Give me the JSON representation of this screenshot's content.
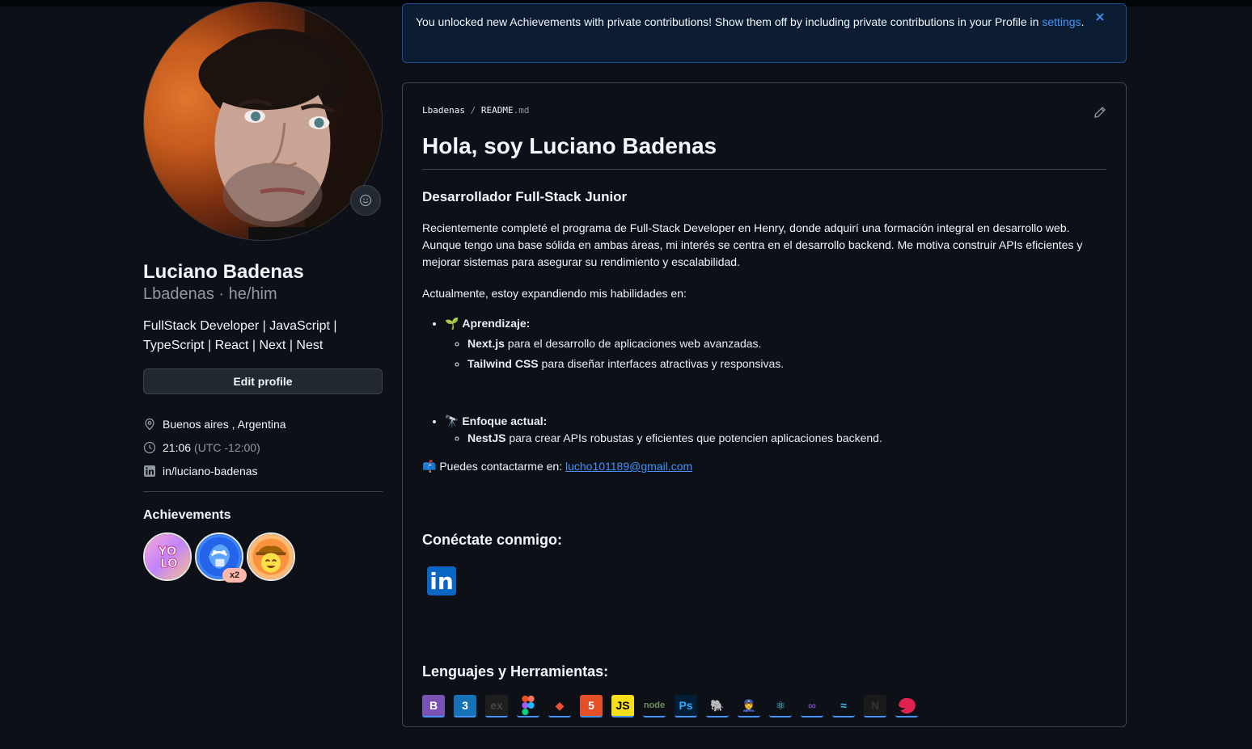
{
  "profile": {
    "name": "Luciano Badenas",
    "username_line": "Lbadenas · he/him",
    "bio_line1": "FullStack Developer | JavaScript |",
    "bio_line2": "TypeScript | React | Next | Nest",
    "edit_label": "Edit profile",
    "location": "Buenos aires , Argentina",
    "time": "21:06",
    "timezone": "(UTC -12:00)",
    "linkedin": "in/luciano-badenas",
    "achievements_title": "Achievements",
    "badge_count": "x2"
  },
  "flash": {
    "text": "You unlocked new Achievements with private contributions! Show them off by including private contributions in your Profile in",
    "link": "settings",
    "tail": "."
  },
  "readme": {
    "path_user": "Lbadenas",
    "path_sep": " / ",
    "path_file": "README",
    "path_ext": ".md",
    "title": "Hola, soy Luciano Badenas",
    "subtitle": "Desarrollador Full-Stack Junior",
    "para1": "Recientemente completé el programa de Full-Stack Developer en Henry, donde adquirí una formación integral en desarrollo web. Aunque tengo una base sólida en ambas áreas, mi interés se centra en el desarrollo backend. Me motiva construir APIs eficientes y mejorar sistemas para asegurar su rendimiento y escalabilidad.",
    "para2": "Actualmente, estoy expandiendo mis habilidades en:",
    "learn_label": "Aprendizaje:",
    "learn_emoji": "🌱",
    "learn_items": [
      {
        "bold": "Next.js",
        "text": " para el desarrollo de aplicaciones web avanzadas."
      },
      {
        "bold": "Tailwind CSS",
        "text": " para diseñar interfaces atractivas y responsivas."
      }
    ],
    "focus_label": "Enfoque actual:",
    "focus_emoji": "🔭",
    "focus_items": [
      {
        "bold": "NestJS",
        "text": " para crear APIs robustas y eficientes que potencien aplicaciones backend."
      }
    ],
    "contact_emoji": "📫",
    "contact_text": "Puedes contactarme en: ",
    "email": "lucho101189@gmail.com",
    "connect_title": "Conéctate conmigo:",
    "linkedin_logo": "in",
    "tools_title": "Lenguajes y Herramientas:",
    "tools": [
      {
        "name": "bootstrap-icon",
        "glyph": "B",
        "bg": "#7952b3",
        "fg": "#ffffff"
      },
      {
        "name": "css3-icon",
        "glyph": "3",
        "bg": "#1572b6",
        "fg": "#ffffff"
      },
      {
        "name": "express-icon",
        "glyph": "ex",
        "bg": "#1e1e1e",
        "fg": "#444444"
      },
      {
        "name": "figma-icon",
        "glyph": "",
        "bg": "transparent",
        "fg": "#ffffff"
      },
      {
        "name": "git-icon",
        "glyph": "◆",
        "bg": "transparent",
        "fg": "#f05032"
      },
      {
        "name": "html5-icon",
        "glyph": "5",
        "bg": "#e34f26",
        "fg": "#ffffff"
      },
      {
        "name": "javascript-icon",
        "glyph": "JS",
        "bg": "#f7df1e",
        "fg": "#000000"
      },
      {
        "name": "nodejs-icon",
        "glyph": "node",
        "bg": "transparent",
        "fg": "#6b8f5e"
      },
      {
        "name": "photoshop-icon",
        "glyph": "Ps",
        "bg": "#001e36",
        "fg": "#31a8ff"
      },
      {
        "name": "postgresql-icon",
        "glyph": "🐘",
        "bg": "transparent",
        "fg": "#ffffff"
      },
      {
        "name": "postman-icon",
        "glyph": "👮",
        "bg": "transparent",
        "fg": "#ffffff"
      },
      {
        "name": "react-icon",
        "glyph": "⚛",
        "bg": "transparent",
        "fg": "#61dafb"
      },
      {
        "name": "redux-icon",
        "glyph": "∞",
        "bg": "transparent",
        "fg": "#764abc"
      },
      {
        "name": "tailwind-icon",
        "glyph": "≈",
        "bg": "transparent",
        "fg": "#38bdf8"
      },
      {
        "name": "nextjs-icon",
        "glyph": "N",
        "bg": "#1a1a1a",
        "fg": "#333333"
      },
      {
        "name": "nestjs-icon",
        "glyph": "",
        "bg": "transparent",
        "fg": "#e0234e"
      }
    ]
  },
  "colors": {
    "background": "#0d1117",
    "accent_link": "#4493f8",
    "border": "#3d444d"
  }
}
